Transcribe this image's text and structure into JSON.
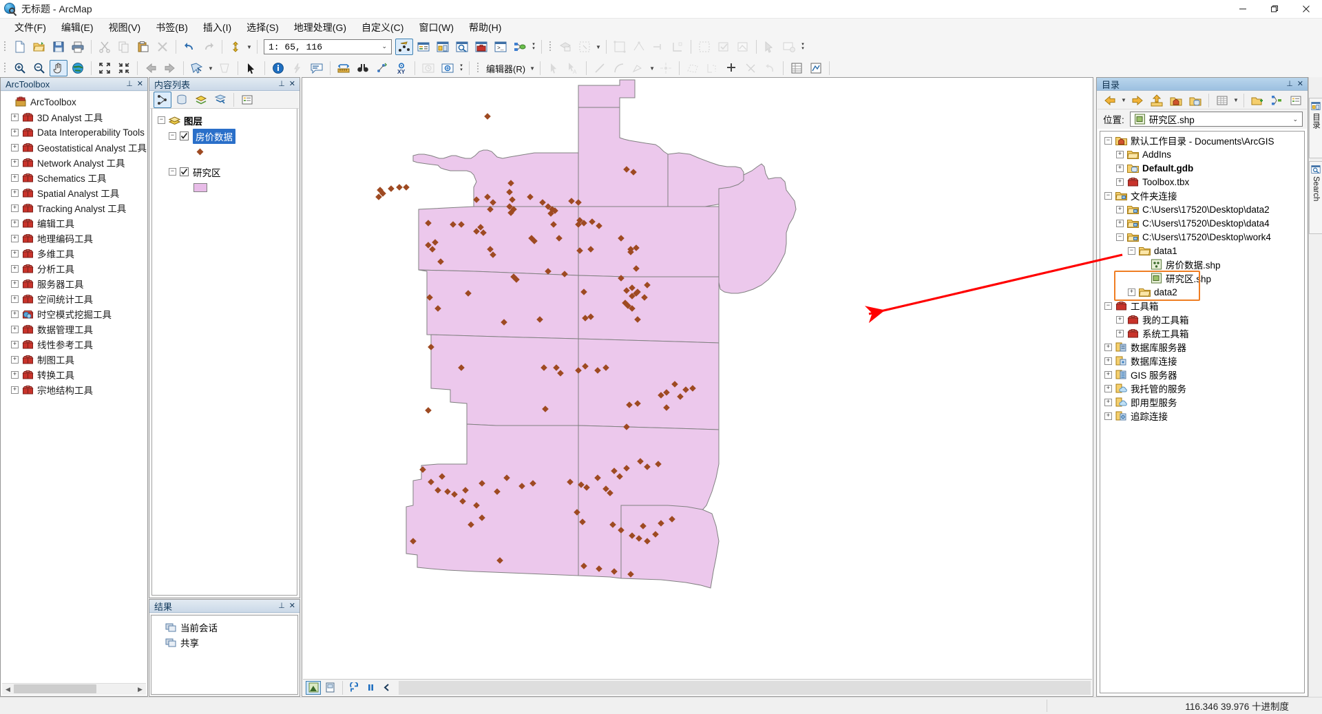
{
  "window": {
    "title": "无标题 - ArcMap",
    "app_icon": "arcmap-globe-icon",
    "minimize": "—",
    "maximize": "❐",
    "close": "✕"
  },
  "menubar": {
    "items": [
      {
        "label": "文件(F)",
        "name": "menu-file"
      },
      {
        "label": "编辑(E)",
        "name": "menu-edit"
      },
      {
        "label": "视图(V)",
        "name": "menu-view"
      },
      {
        "label": "书签(B)",
        "name": "menu-bookmarks"
      },
      {
        "label": "插入(I)",
        "name": "menu-insert"
      },
      {
        "label": "选择(S)",
        "name": "menu-selection"
      },
      {
        "label": "地理处理(G)",
        "name": "menu-geoprocessing"
      },
      {
        "label": "自定义(C)",
        "name": "menu-customize"
      },
      {
        "label": "窗口(W)",
        "name": "menu-window"
      },
      {
        "label": "帮助(H)",
        "name": "menu-help"
      }
    ]
  },
  "toolbar": {
    "scale_value": "1: 65, 116",
    "editor_label": "编辑器(R)"
  },
  "arctoolbox": {
    "title": "ArcToolbox",
    "pin": "⊥",
    "close": "✕",
    "root": "ArcToolbox",
    "items": [
      {
        "label": "3D Analyst 工具"
      },
      {
        "label": "Data Interoperability Tools"
      },
      {
        "label": "Geostatistical Analyst 工具"
      },
      {
        "label": "Network Analyst 工具"
      },
      {
        "label": "Schematics 工具"
      },
      {
        "label": "Spatial Analyst 工具"
      },
      {
        "label": "Tracking Analyst 工具"
      },
      {
        "label": "编辑工具"
      },
      {
        "label": "地理编码工具"
      },
      {
        "label": "多维工具"
      },
      {
        "label": "分析工具"
      },
      {
        "label": "服务器工具"
      },
      {
        "label": "空间统计工具"
      },
      {
        "label": "时空模式挖掘工具"
      },
      {
        "label": "数据管理工具"
      },
      {
        "label": "线性参考工具"
      },
      {
        "label": "制图工具"
      },
      {
        "label": "转换工具"
      },
      {
        "label": "宗地结构工具"
      }
    ]
  },
  "toc": {
    "title": "内容列表",
    "pin": "⊥",
    "close": "✕",
    "root": "图层",
    "layers": [
      {
        "name": "房价数据",
        "selected": true,
        "symbol": "point",
        "checked": true
      },
      {
        "name": "研究区",
        "selected": false,
        "symbol": "polygon",
        "checked": true
      }
    ]
  },
  "results": {
    "title": "结果",
    "pin": "⊥",
    "close": "✕",
    "items": [
      {
        "label": "当前会话"
      },
      {
        "label": "共享"
      }
    ]
  },
  "catalog": {
    "title": "目录",
    "pin": "⊥",
    "close": "✕",
    "location_label": "位置:",
    "location_value": "研究区.shp",
    "tree": [
      {
        "label": "默认工作目录 - Documents\\ArcGIS",
        "indent": 0,
        "expander": "minus",
        "icon": "home-folder-icon",
        "bold": false
      },
      {
        "label": "AddIns",
        "indent": 1,
        "expander": "plus",
        "icon": "folder-icon",
        "bold": false
      },
      {
        "label": "Default.gdb",
        "indent": 1,
        "expander": "plus",
        "icon": "gdb-icon",
        "bold": true
      },
      {
        "label": "Toolbox.tbx",
        "indent": 1,
        "expander": "plus",
        "icon": "toolbox-icon",
        "bold": false
      },
      {
        "label": "文件夹连接",
        "indent": 0,
        "expander": "minus",
        "icon": "folder-connection-icon",
        "bold": false
      },
      {
        "label": "C:\\Users\\17520\\Desktop\\data2",
        "indent": 1,
        "expander": "plus",
        "icon": "folder-connection-icon",
        "bold": false
      },
      {
        "label": "C:\\Users\\17520\\Desktop\\data4",
        "indent": 1,
        "expander": "plus",
        "icon": "folder-connection-icon",
        "bold": false
      },
      {
        "label": "C:\\Users\\17520\\Desktop\\work4",
        "indent": 1,
        "expander": "minus",
        "icon": "folder-connection-icon",
        "bold": false
      },
      {
        "label": "data1",
        "indent": 2,
        "expander": "minus",
        "icon": "folder-icon",
        "bold": false
      },
      {
        "label": "房价数据.shp",
        "indent": 3,
        "expander": "none",
        "icon": "point-shapefile-icon",
        "bold": false
      },
      {
        "label": "研究区.shp",
        "indent": 3,
        "expander": "none",
        "icon": "polygon-shapefile-icon",
        "bold": false
      },
      {
        "label": "data2",
        "indent": 2,
        "expander": "plus",
        "icon": "folder-icon",
        "bold": false
      },
      {
        "label": "工具箱",
        "indent": 0,
        "expander": "minus",
        "icon": "toolbox-icon",
        "bold": false
      },
      {
        "label": "我的工具箱",
        "indent": 1,
        "expander": "plus",
        "icon": "toolbox-icon",
        "bold": false
      },
      {
        "label": "系统工具箱",
        "indent": 1,
        "expander": "plus",
        "icon": "toolbox-icon",
        "bold": false
      },
      {
        "label": "数据库服务器",
        "indent": 0,
        "expander": "plus",
        "icon": "db-server-icon",
        "bold": false
      },
      {
        "label": "数据库连接",
        "indent": 0,
        "expander": "plus",
        "icon": "db-connection-icon",
        "bold": false
      },
      {
        "label": "GIS 服务器",
        "indent": 0,
        "expander": "plus",
        "icon": "gis-server-icon",
        "bold": false
      },
      {
        "label": "我托管的服务",
        "indent": 0,
        "expander": "plus",
        "icon": "cloud-icon",
        "bold": false
      },
      {
        "label": "即用型服务",
        "indent": 0,
        "expander": "plus",
        "icon": "cloud-icon",
        "bold": false
      },
      {
        "label": "追踪连接",
        "indent": 0,
        "expander": "plus",
        "icon": "tracking-icon",
        "bold": false
      }
    ],
    "highlight_color": "#ef7d22"
  },
  "side_tabs": [
    {
      "label": "目录",
      "name": "side-tab-catalog",
      "icon": "catalog-icon"
    },
    {
      "label": "Search",
      "name": "side-tab-search",
      "icon": "search-icon"
    }
  ],
  "statusbar": {
    "coords": "116.346  39.976 十进制度"
  },
  "map": {
    "layer_fill": "#ecc8ec",
    "layer_stroke": "#808080",
    "point_color": "#9e4a22",
    "annotation_arrow_color": "#ff0000",
    "bottom_buttons": [
      "data-view-button",
      "layout-view-button",
      "refresh-button",
      "pause-button",
      "back-button"
    ]
  }
}
